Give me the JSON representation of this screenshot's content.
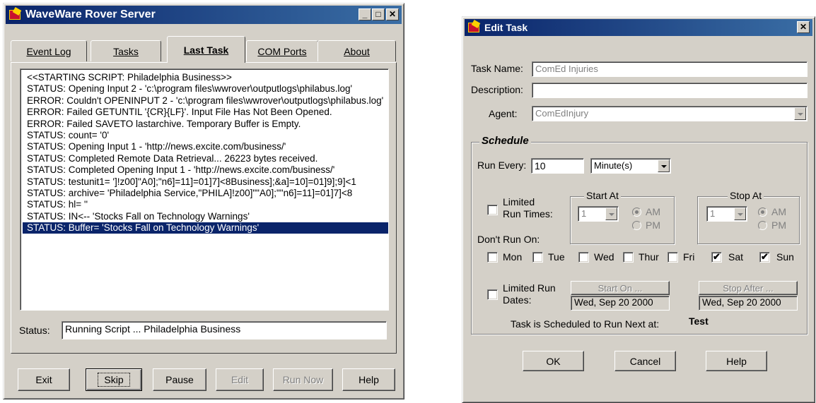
{
  "rover": {
    "title": "WaveWare Rover Server",
    "tabs": [
      "Event Log",
      "Tasks",
      "Last Task",
      "COM Ports",
      "About"
    ],
    "log_lines": [
      "<<STARTING SCRIPT: Philadelphia Business>>",
      "STATUS: Opening Input 2 - 'c:\\program files\\wwrover\\outputlogs\\philabus.log'",
      "ERROR: Couldn't OPENINPUT 2 - 'c:\\program files\\wwrover\\outputlogs\\philabus.log'",
      "ERROR: Failed GETUNTIL '{CR}{LF}'. Input File Has Not Been Opened.",
      "ERROR: Failed SAVETO lastarchive. Temporary Buffer is Empty.",
      "STATUS: count= '0'",
      "STATUS: Opening Input 1 - 'http://news.excite.com/business/'",
      "STATUS: Completed Remote Data Retrieval... 26223 bytes received.",
      "STATUS: Completed Opening Input 1 - 'http://news.excite.com/business/'",
      "STATUS: testunit1= ']!z00]\"A0];\"n6]=11]=01]7]<8Business];&a]=10]=01]9];9]<1",
      "STATUS: archive= 'Philadelphia Service,\"PHILA]!z00]\"\"A0];\"\"n6]=11]=01]7]<8",
      "STATUS: hl= ''",
      "STATUS: IN<-- 'Stocks Fall on Technology Warnings'",
      "STATUS: Buffer= 'Stocks Fall on Technology Warnings'"
    ],
    "status_label": "Status:",
    "status_value": "Running Script ... Philadelphia Business",
    "buttons": [
      "Exit",
      "Skip",
      "Pause",
      "Edit",
      "Run Now",
      "Help"
    ]
  },
  "edit": {
    "title": "Edit Task",
    "task_name_label": "Task Name:",
    "task_name_value": "ComEd Injuries",
    "description_label": "Description:",
    "description_value": "",
    "agent_label": "Agent:",
    "agent_value": "ComEdInjury",
    "schedule_title": "Schedule",
    "run_every_label": "Run Every:",
    "run_every_value": "10",
    "run_every_unit": "Minute(s)",
    "limited_run_times_label_1": "Limited",
    "limited_run_times_label_2": "Run Times:",
    "start_at_title": "Start At",
    "stop_at_title": "Stop At",
    "start_hour": "1",
    "stop_hour": "1",
    "am_label": "AM",
    "pm_label": "PM",
    "dont_run_on_label": "Don't Run On:",
    "days": [
      {
        "label": "Mon",
        "checked": false,
        "mark": ""
      },
      {
        "label": "Tue",
        "checked": false,
        "mark": ""
      },
      {
        "label": "Wed",
        "checked": false,
        "mark": ""
      },
      {
        "label": "Thur",
        "checked": false,
        "mark": ""
      },
      {
        "label": "Fri",
        "checked": false,
        "mark": ""
      },
      {
        "label": "Sat",
        "checked": true,
        "mark": "✔"
      },
      {
        "label": "Sun",
        "checked": true,
        "mark": "✔"
      }
    ],
    "limited_run_dates_label_1": "Limited Run",
    "limited_run_dates_label_2": "Dates:",
    "start_on_button": "Start On ...",
    "stop_after_button": "Stop After ...",
    "start_on_value": "Wed, Sep 20 2000",
    "stop_after_value": "Wed, Sep 20 2000",
    "next_run_label": "Task is Scheduled to Run Next at:",
    "next_run_value": "Test",
    "ok_button": "OK",
    "cancel_button": "Cancel",
    "help_button": "Help"
  }
}
